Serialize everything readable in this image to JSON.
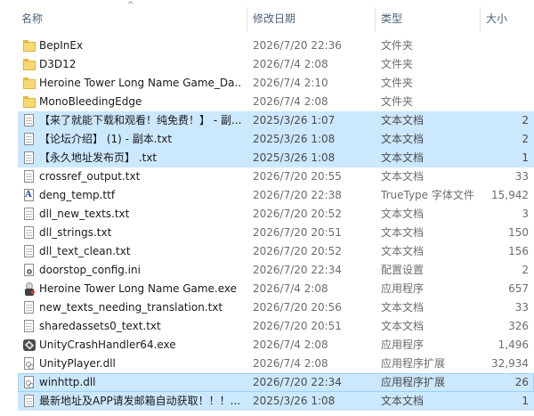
{
  "header": {
    "name_label": "名称",
    "date_label": "修改日期",
    "type_label": "类型",
    "size_label": "大小",
    "sort_arrow": "^"
  },
  "files": [
    {
      "name": "BepInEx",
      "date": "2026/7/20 22:36",
      "type": "文件夹",
      "size": "",
      "icon": "folder-icon",
      "selected": false
    },
    {
      "name": "D3D12",
      "date": "2026/7/4 2:08",
      "type": "文件夹",
      "size": "",
      "icon": "folder-icon",
      "selected": false
    },
    {
      "name": "Heroine Tower Long Name Game_Da...",
      "date": "2026/7/4 2:10",
      "type": "文件夹",
      "size": "",
      "icon": "folder-icon",
      "selected": false
    },
    {
      "name": "MonoBleedingEdge",
      "date": "2026/7/4 2:08",
      "type": "文件夹",
      "size": "",
      "icon": "folder-icon",
      "selected": false
    },
    {
      "name": "【来了就能下载和观看！纯免费！】 - 副...",
      "date": "2025/3/26 1:07",
      "type": "文本文档",
      "size": "2",
      "icon": "text-document-icon",
      "selected": true
    },
    {
      "name": "【论坛介绍】 (1) - 副本.txt",
      "date": "2025/3/26 1:08",
      "type": "文本文档",
      "size": "2",
      "icon": "text-document-icon",
      "selected": true
    },
    {
      "name": "【永久地址发布页】 .txt",
      "date": "2025/3/26 1:08",
      "type": "文本文档",
      "size": "1",
      "icon": "text-document-icon",
      "selected": true
    },
    {
      "name": "crossref_output.txt",
      "date": "2026/7/20 20:55",
      "type": "文本文档",
      "size": "33",
      "icon": "text-document-icon",
      "selected": false
    },
    {
      "name": "deng_temp.ttf",
      "date": "2026/7/20 22:38",
      "type": "TrueType 字体文件",
      "size": "15,942",
      "icon": "font-file-icon",
      "selected": false
    },
    {
      "name": "dll_new_texts.txt",
      "date": "2026/7/20 20:52",
      "type": "文本文档",
      "size": "3",
      "icon": "text-document-icon",
      "selected": false
    },
    {
      "name": "dll_strings.txt",
      "date": "2026/7/20 20:51",
      "type": "文本文档",
      "size": "150",
      "icon": "text-document-icon",
      "selected": false
    },
    {
      "name": "dll_text_clean.txt",
      "date": "2026/7/20 20:52",
      "type": "文本文档",
      "size": "156",
      "icon": "text-document-icon",
      "selected": false
    },
    {
      "name": "doorstop_config.ini",
      "date": "2026/7/20 22:34",
      "type": "配置设置",
      "size": "2",
      "icon": "config-file-icon",
      "selected": false
    },
    {
      "name": "Heroine Tower Long Name Game.exe",
      "date": "2026/7/4 2:08",
      "type": "应用程序",
      "size": "657",
      "icon": "application-icon",
      "selected": false
    },
    {
      "name": "new_texts_needing_translation.txt",
      "date": "2026/7/20 20:56",
      "type": "文本文档",
      "size": "33",
      "icon": "text-document-icon",
      "selected": false
    },
    {
      "name": "sharedassets0_text.txt",
      "date": "2026/7/20 20:51",
      "type": "文本文档",
      "size": "326",
      "icon": "text-document-icon",
      "selected": false
    },
    {
      "name": "UnityCrashHandler64.exe",
      "date": "2026/7/4 2:08",
      "type": "应用程序",
      "size": "1,496",
      "icon": "unity-app-icon",
      "selected": false
    },
    {
      "name": "UnityPlayer.dll",
      "date": "2026/7/4 2:08",
      "type": "应用程序扩展",
      "size": "32,934",
      "icon": "dll-file-icon",
      "selected": false
    },
    {
      "name": "winhttp.dll",
      "date": "2026/7/20 22:34",
      "type": "应用程序扩展",
      "size": "26",
      "icon": "dll-file-icon",
      "selected": true
    },
    {
      "name": "最新地址及APP请发邮箱自动获取！！！...",
      "date": "2025/3/26 1:08",
      "type": "文本文档",
      "size": "1",
      "icon": "text-document-icon",
      "selected": true
    }
  ],
  "colors": {
    "selection_bg": "#cce8ff",
    "header_text": "#4c607a",
    "folder": "#f8d775"
  }
}
